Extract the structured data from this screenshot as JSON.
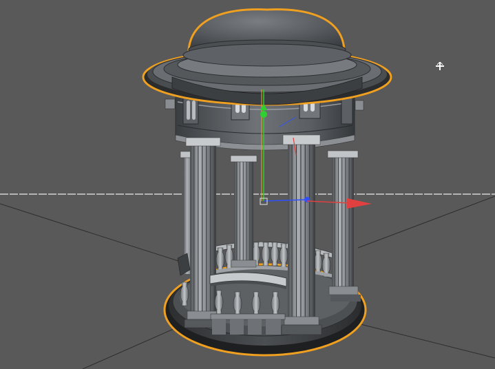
{
  "viewport": {
    "background": "#595959",
    "horizon_color": "#cfcfcf",
    "grid_line_color": "#2b2b2b",
    "selection_outline_color": "#f0a020"
  },
  "object": {
    "type": "gazebo / rotunda model",
    "selected": true,
    "column_count": 6,
    "parts": [
      "dome",
      "cornice",
      "drum-frieze",
      "columns",
      "balustrade",
      "platform-base"
    ]
  },
  "gizmo": {
    "type": "move-tool",
    "axes": [
      {
        "axis": "x",
        "color": "#e04040"
      },
      {
        "axis": "y",
        "color": "#30d030"
      },
      {
        "axis": "z",
        "color": "#3050ff"
      }
    ]
  },
  "icons": {
    "cursor": "mouse-pointer-icon"
  }
}
